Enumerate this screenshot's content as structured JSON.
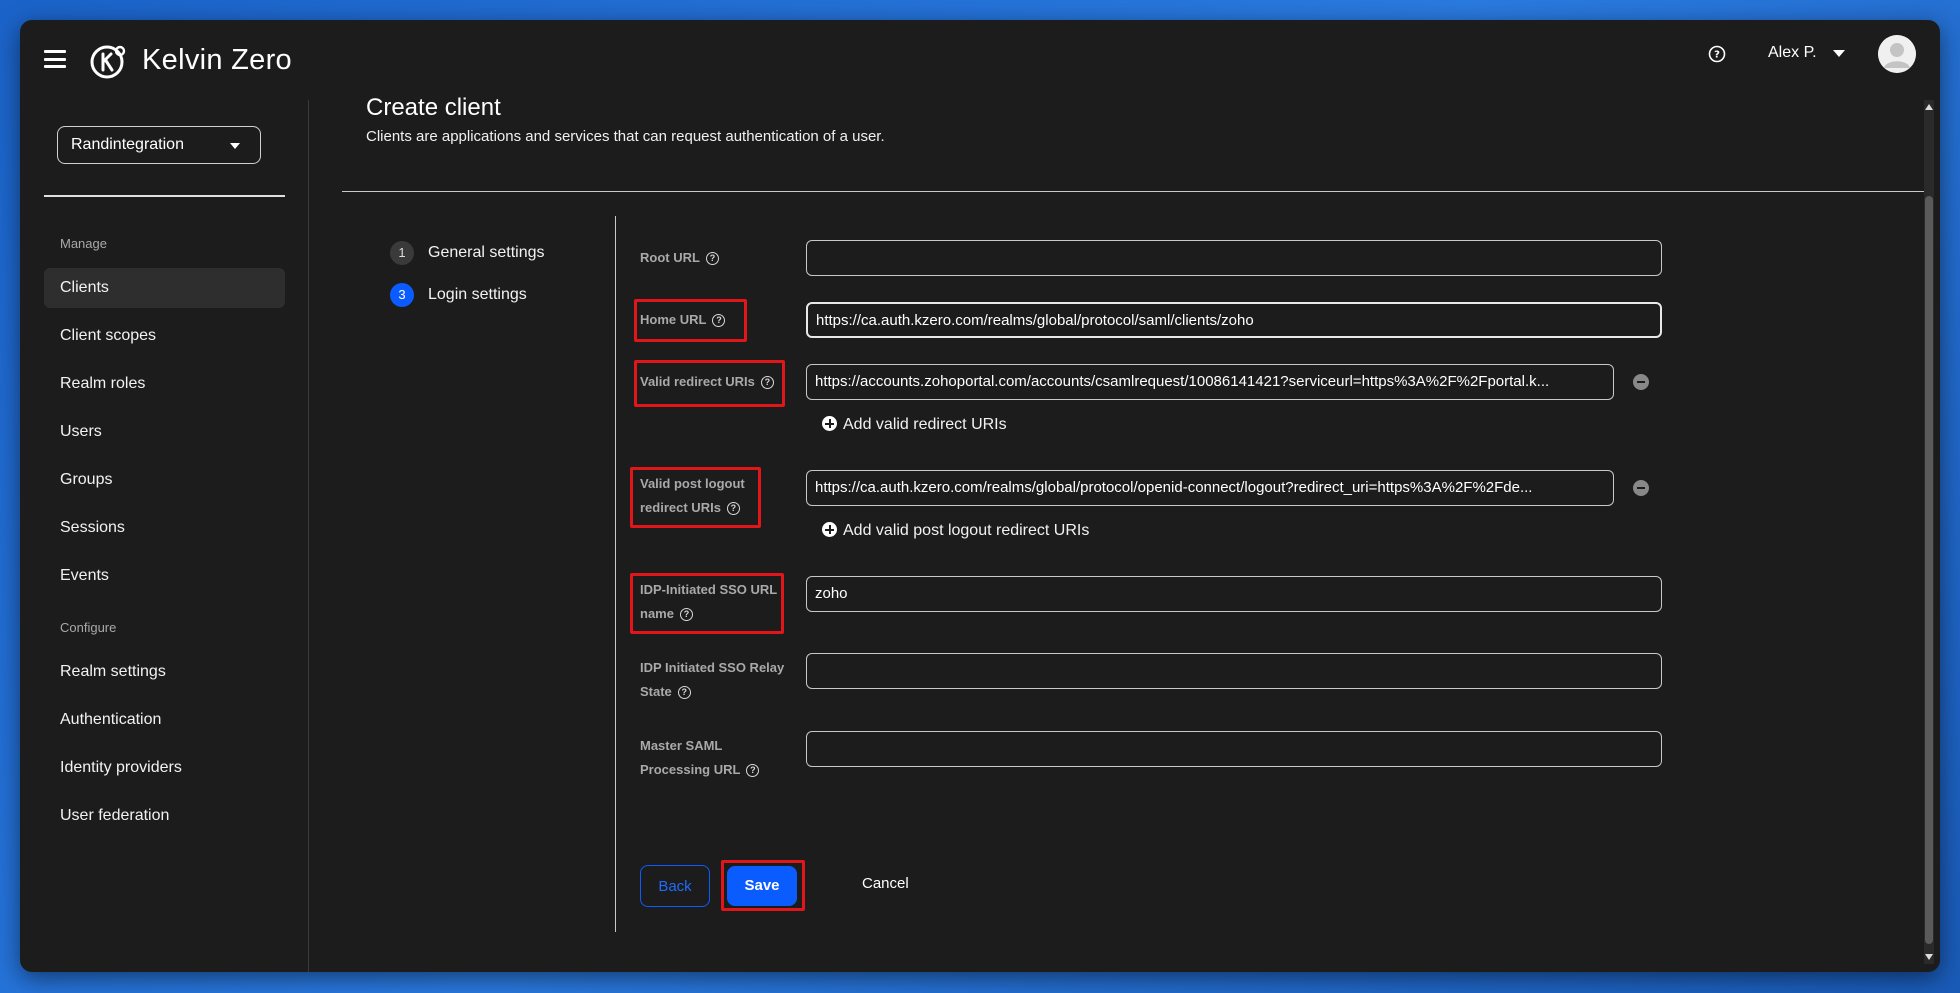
{
  "header": {
    "app_title": "Kelvin Zero",
    "user_name": "Alex P.",
    "help_glyph": "?"
  },
  "sidebar": {
    "realm": "Randintegration",
    "manage_label": "Manage",
    "configure_label": "Configure",
    "manage_items": [
      {
        "label": "Clients"
      },
      {
        "label": "Client scopes"
      },
      {
        "label": "Realm roles"
      },
      {
        "label": "Users"
      },
      {
        "label": "Groups"
      },
      {
        "label": "Sessions"
      },
      {
        "label": "Events"
      }
    ],
    "configure_items": [
      {
        "label": "Realm settings"
      },
      {
        "label": "Authentication"
      },
      {
        "label": "Identity providers"
      },
      {
        "label": "User federation"
      }
    ]
  },
  "page": {
    "title": "Create client",
    "subtitle": "Clients are applications and services that can request authentication of a user."
  },
  "steps": [
    {
      "num": "1",
      "label": "General settings"
    },
    {
      "num": "3",
      "label": "Login settings"
    }
  ],
  "form": {
    "root_url": {
      "label": "Root URL",
      "value": ""
    },
    "home_url": {
      "label": "Home URL",
      "value": "https://ca.auth.kzero.com/realms/global/protocol/saml/clients/zoho"
    },
    "redirect_uris": {
      "label": "Valid redirect URIs",
      "value": "https://accounts.zohoportal.com/accounts/csamlrequest/10086141421?serviceurl=https%3A%2F%2Fportal.k...",
      "add_label": "Add valid redirect URIs"
    },
    "post_logout": {
      "label_line1": "Valid post logout",
      "label_line2": "redirect URIs",
      "value": "https://ca.auth.kzero.com/realms/global/protocol/openid-connect/logout?redirect_uri=https%3A%2F%2Fde...",
      "add_label": "Add valid post logout redirect URIs"
    },
    "idp_sso_name": {
      "label_line1": "IDP-Initiated SSO URL",
      "label_line2": "name",
      "value": "zoho"
    },
    "idp_relay_state": {
      "label_line1": "IDP Initiated SSO Relay",
      "label_line2": "State",
      "value": ""
    },
    "master_saml": {
      "label_line1": "Master SAML",
      "label_line2": "Processing URL",
      "value": ""
    }
  },
  "buttons": {
    "back": "Back",
    "save": "Save",
    "cancel": "Cancel"
  },
  "colors": {
    "primary": "#0b5cff",
    "highlight": "#e0161b",
    "background": "#1c1c1c"
  }
}
